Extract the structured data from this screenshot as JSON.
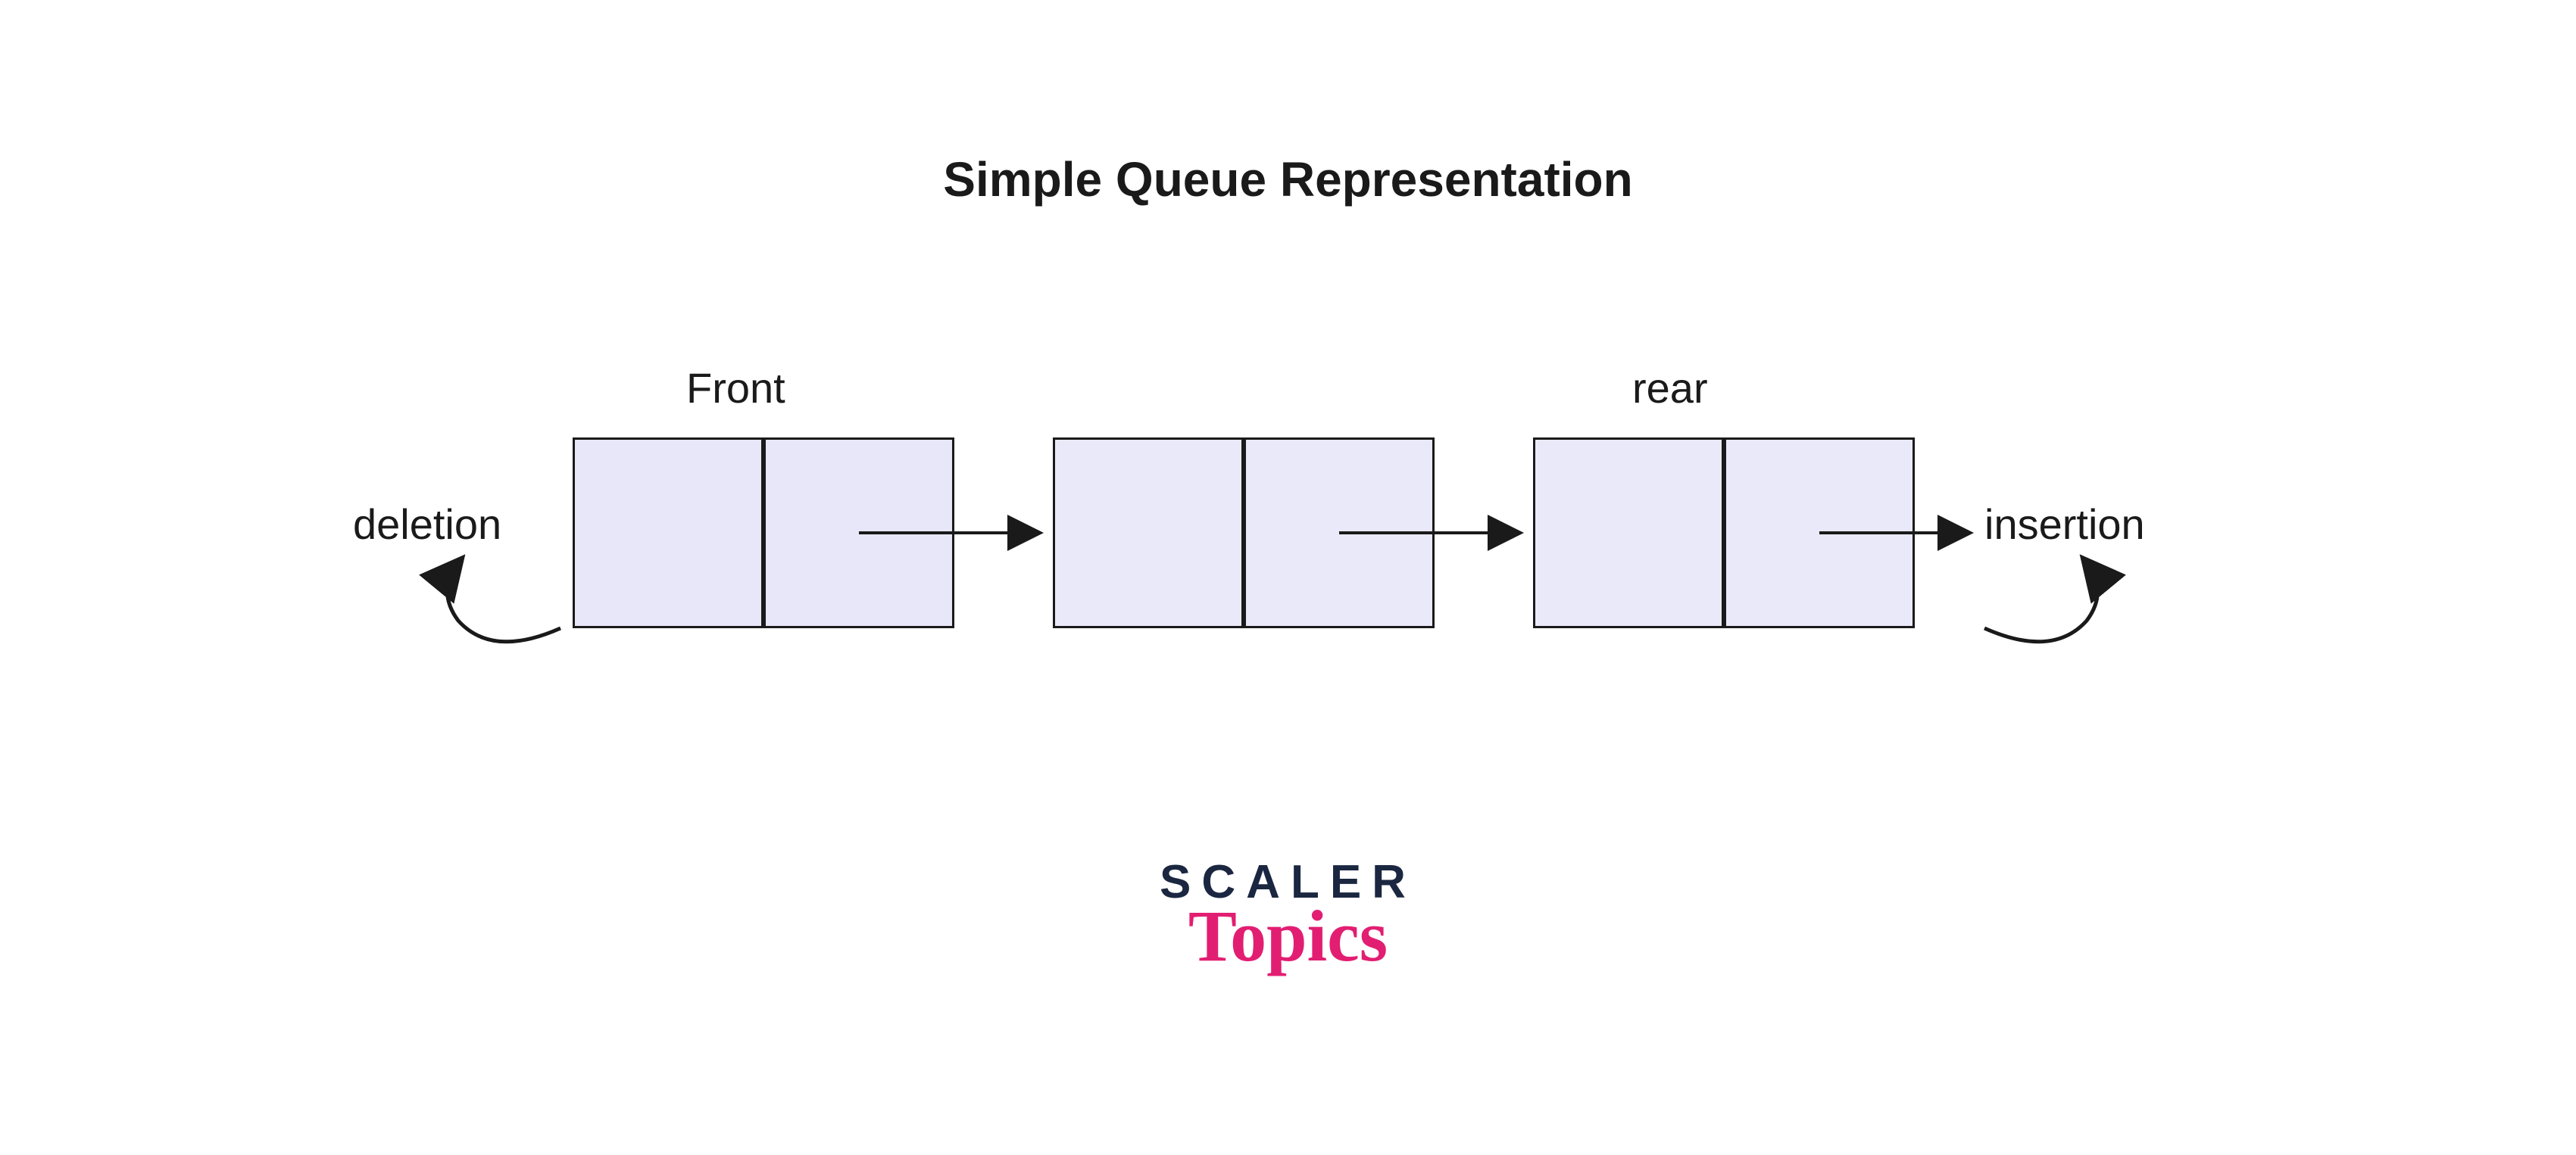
{
  "title": "Simple Queue Representation",
  "labels": {
    "front": "Front",
    "rear": "rear",
    "deletion": "deletion",
    "insertion": "insertion"
  },
  "logo": {
    "line1": "SCALER",
    "line2": "Topics"
  },
  "colors": {
    "nodeFill": "#e7e7f9",
    "stroke": "#1a1a1a",
    "logoDark": "#1b2740",
    "logoPink": "#e21e72"
  },
  "diagram": {
    "type": "queue-linked-list",
    "nodes": 3,
    "arrows": [
      "deletion-curve",
      "node1->node2",
      "node2->node3",
      "node3->insertion",
      "insertion-curve"
    ]
  }
}
